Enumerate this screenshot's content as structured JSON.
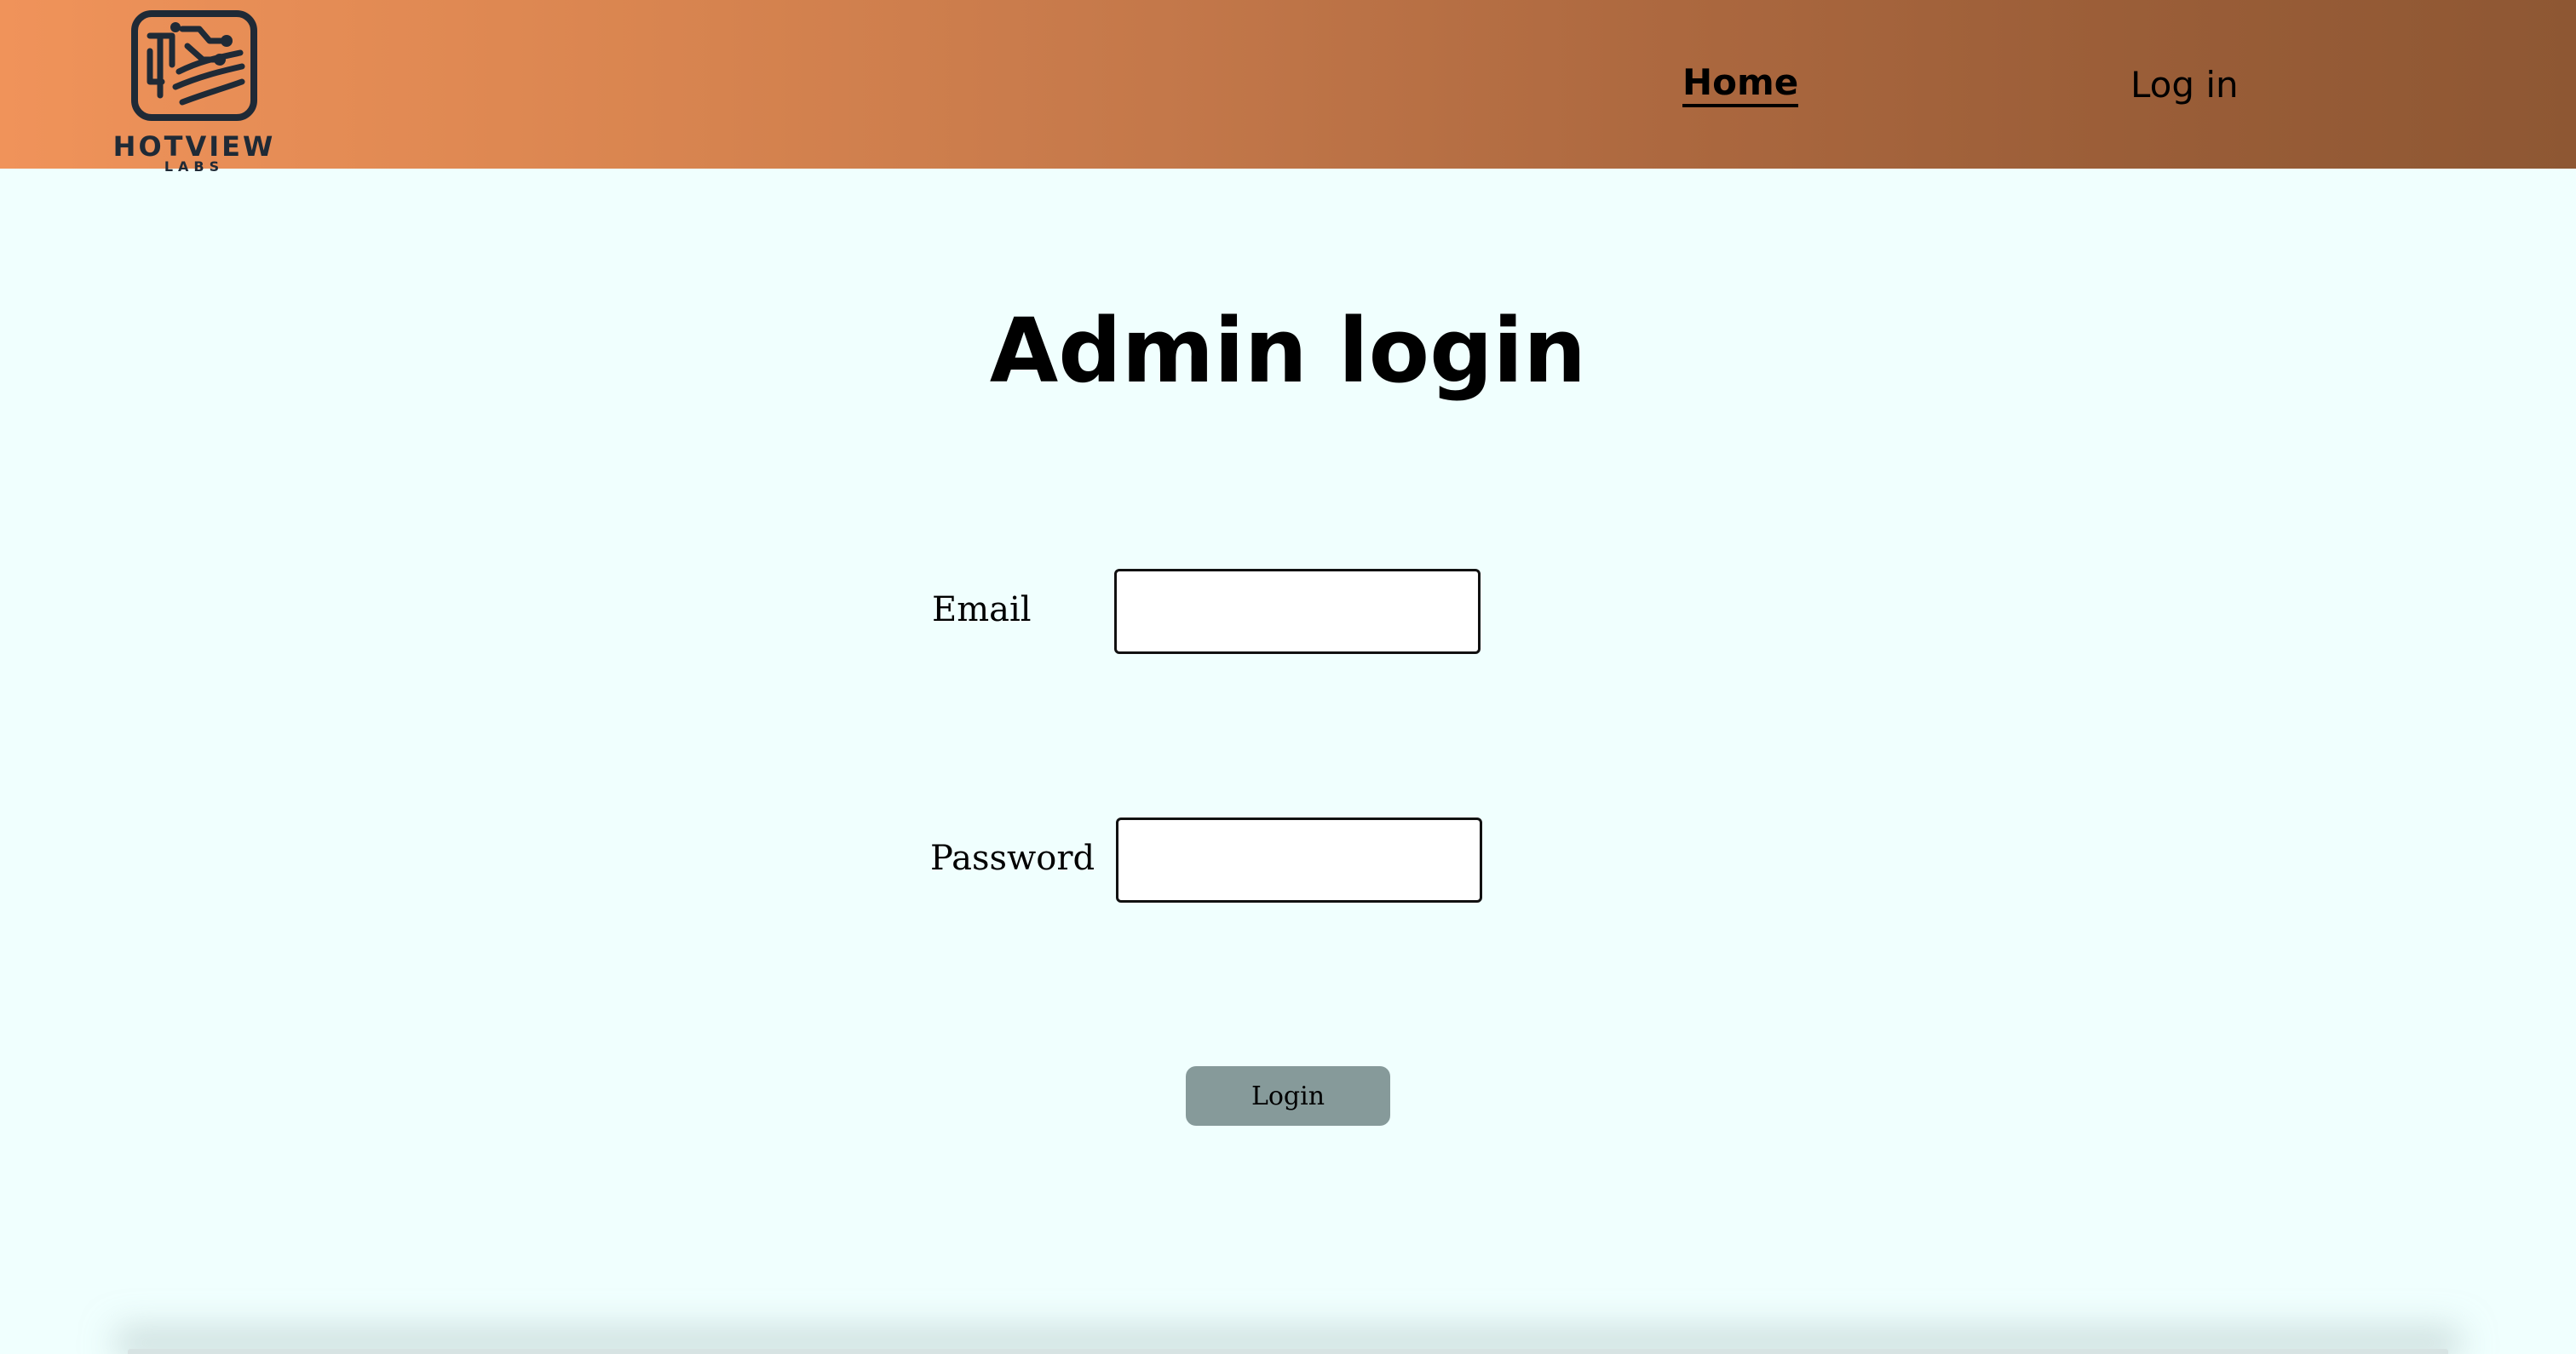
{
  "header": {
    "logo": {
      "name": "HOTVIEW",
      "sub": "LABS",
      "icon": "circuit-board-icon"
    },
    "nav": {
      "home_label": "Home",
      "login_label": "Log in"
    }
  },
  "main": {
    "title": "Admin login",
    "form": {
      "email_label": "Email",
      "email_value": "",
      "password_label": "Password",
      "password_value": "",
      "submit_label": "Login"
    }
  },
  "colors": {
    "header_gradient_start": "#f0935a",
    "header_gradient_end": "#8e5733",
    "background": "#f0fffe",
    "button": "#869a9a",
    "logo_ink": "#1f2a36"
  }
}
